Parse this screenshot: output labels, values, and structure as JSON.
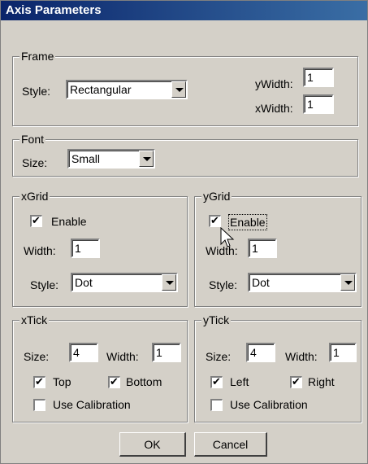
{
  "title": "Axis Parameters",
  "frame": {
    "legend": "Frame",
    "style_label": "Style:",
    "style_value": "Rectangular",
    "ywidth_label": "yWidth:",
    "ywidth_value": "1",
    "xwidth_label": "xWidth:",
    "xwidth_value": "1"
  },
  "font": {
    "legend": "Font",
    "size_label": "Size:",
    "size_value": "Small"
  },
  "xgrid": {
    "legend": "xGrid",
    "enable_label": "Enable",
    "enable_checked": true,
    "width_label": "Width:",
    "width_value": "1",
    "style_label": "Style:",
    "style_value": "Dot"
  },
  "ygrid": {
    "legend": "yGrid",
    "enable_label": "Enable",
    "enable_checked": true,
    "width_label": "Width:",
    "width_value": "1",
    "style_label": "Style:",
    "style_value": "Dot"
  },
  "xtick": {
    "legend": "xTick",
    "size_label": "Size:",
    "size_value": "4",
    "width_label": "Width:",
    "width_value": "1",
    "top_label": "Top",
    "top_checked": true,
    "bottom_label": "Bottom",
    "bottom_checked": true,
    "calib_label": "Use Calibration",
    "calib_checked": false
  },
  "ytick": {
    "legend": "yTick",
    "size_label": "Size:",
    "size_value": "4",
    "width_label": "Width:",
    "width_value": "1",
    "left_label": "Left",
    "left_checked": true,
    "right_label": "Right",
    "right_checked": true,
    "calib_label": "Use Calibration",
    "calib_checked": false
  },
  "buttons": {
    "ok": "OK",
    "cancel": "Cancel"
  },
  "colors": {
    "titlebar_start": "#0a246a",
    "titlebar_end": "#3a6ea5",
    "dialog_bg": "#d4d0c8"
  },
  "icons": [
    "dropdown-arrow-icon",
    "checkmark-icon",
    "mouse-pointer-icon"
  ]
}
